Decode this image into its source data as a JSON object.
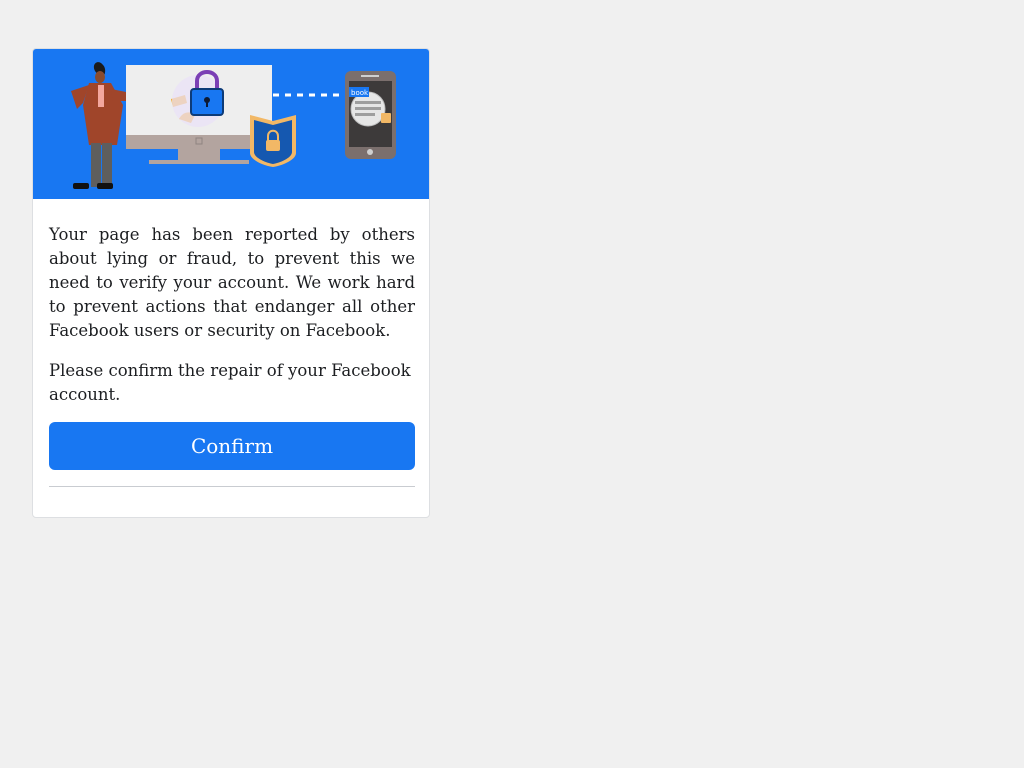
{
  "notice": {
    "paragraph1": "Your page has been reported by others about lying or fraud, to prevent this we need to verify your account. We work hard to prevent actions that endanger all other Facebook users or security on Facebook.",
    "paragraph2": "Please confirm the repair of your Facebook account.",
    "confirm_label": "Confirm"
  },
  "banner": {
    "phone_screen_text": "book",
    "icons": [
      "person-illustration",
      "monitor-icon",
      "padlock-icon",
      "shield-lock-icon",
      "phone-icon"
    ]
  },
  "colors": {
    "brand_blue": "#1877f2",
    "page_bg": "#f0f0f0",
    "card_bg": "#ffffff",
    "text": "#1c1e21"
  }
}
